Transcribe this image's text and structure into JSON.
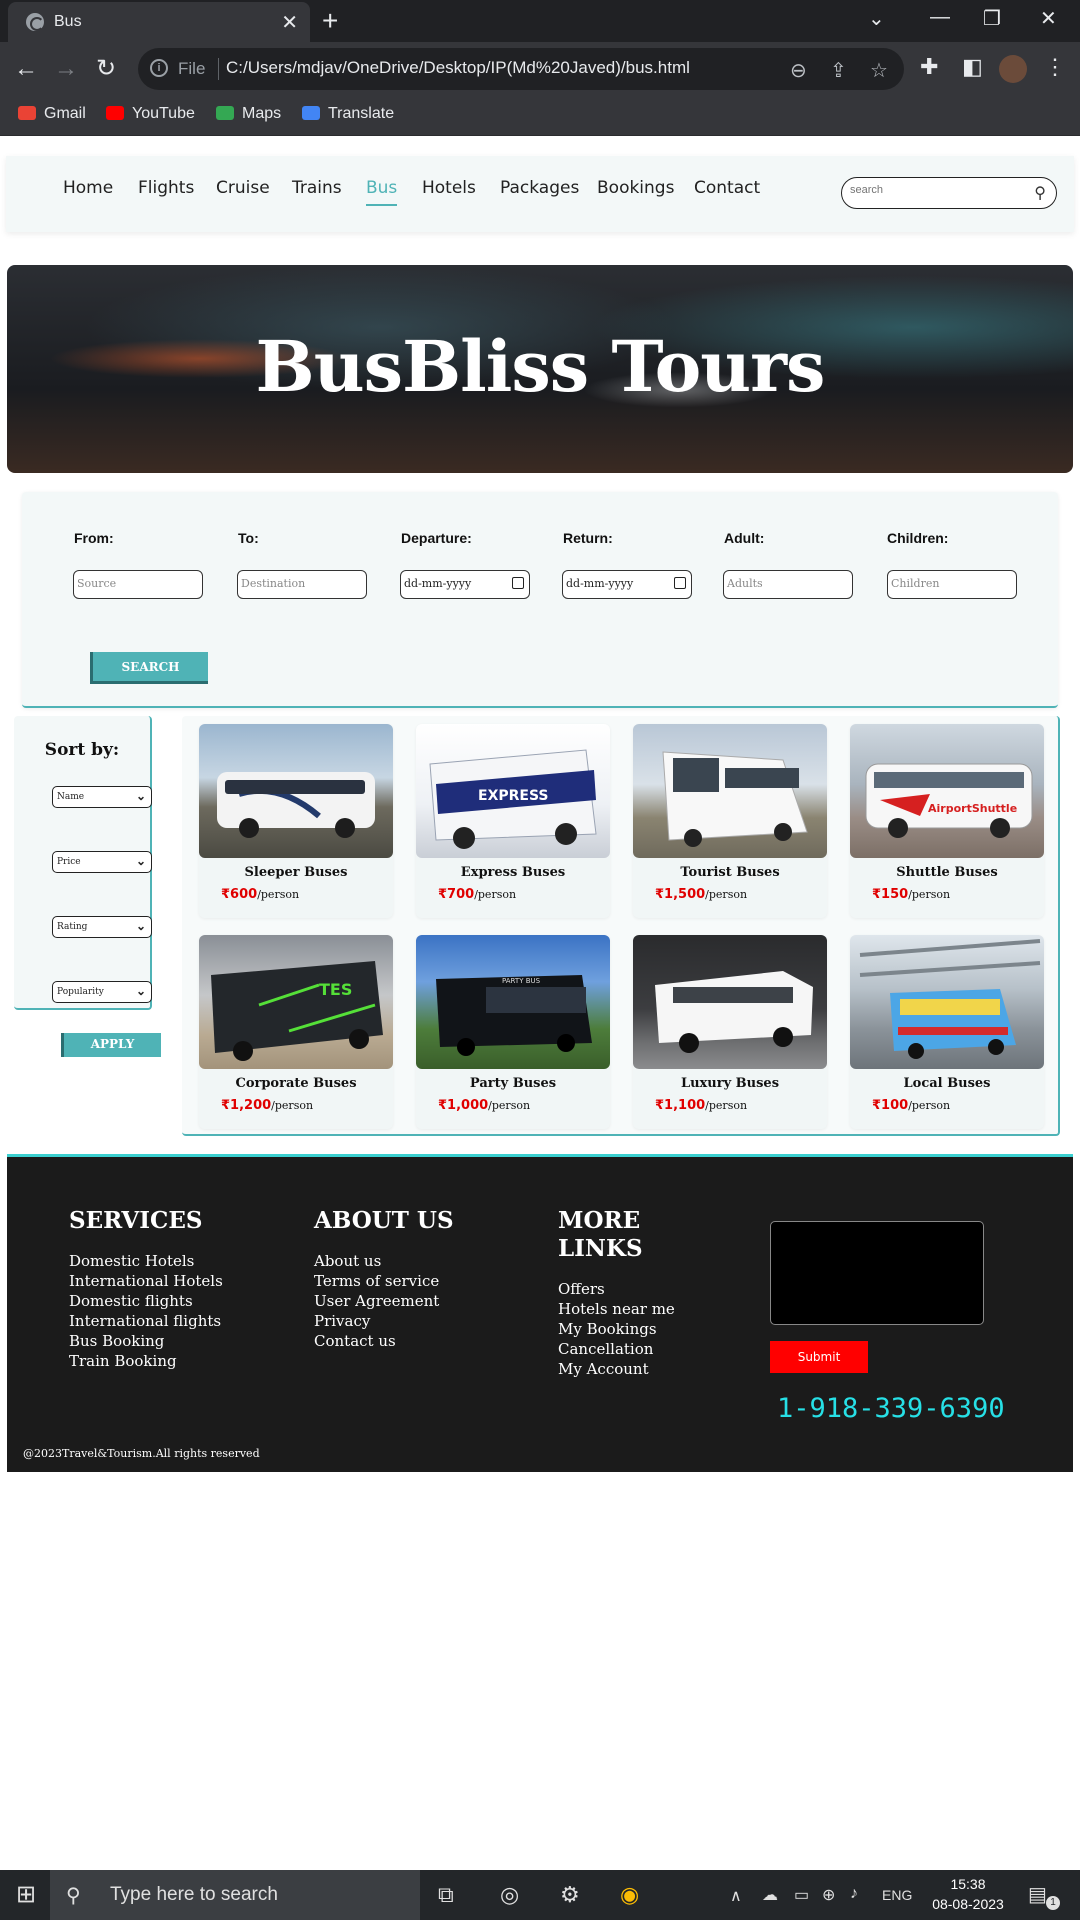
{
  "browser": {
    "tab_title": "Bus",
    "url_scheme": "File",
    "url": "C:/Users/mdjav/OneDrive/Desktop/IP(Md%20Javed)/bus.html",
    "bookmarks": [
      "Gmail",
      "YouTube",
      "Maps",
      "Translate"
    ]
  },
  "nav": {
    "links": [
      "Home",
      "Flights",
      "Cruise",
      "Trains",
      "Bus",
      "Hotels",
      "Packages",
      "Bookings",
      "Contact"
    ],
    "active": "Bus",
    "search_placeholder": "search"
  },
  "hero": {
    "title": "BusBliss Tours"
  },
  "search_form": {
    "from_label": "From:",
    "from_placeholder": "Source",
    "to_label": "To:",
    "to_placeholder": "Destination",
    "departure_label": "Departure:",
    "departure_value": "dd-mm-yyyy",
    "return_label": "Return:",
    "return_value": "dd-mm-yyyy",
    "adult_label": "Adult:",
    "adult_placeholder": "Adults",
    "children_label": "Children:",
    "children_placeholder": "Children",
    "search_button": "SEARCH"
  },
  "sidebar": {
    "title": "Sort by:",
    "selects": [
      "Name",
      "Price",
      "Rating",
      "Popularity"
    ],
    "apply_button": "APPLY"
  },
  "buses": [
    {
      "name": "Sleeper Buses",
      "price": "₹600",
      "unit": "/person"
    },
    {
      "name": "Express Buses",
      "price": "₹700",
      "unit": "/person"
    },
    {
      "name": "Tourist Buses",
      "price": "₹1,500",
      "unit": "/person"
    },
    {
      "name": "Shuttle Buses",
      "price": "₹150",
      "unit": "/person"
    },
    {
      "name": "Corporate Buses",
      "price": "₹1,200",
      "unit": "/person"
    },
    {
      "name": "Party Buses",
      "price": "₹1,000",
      "unit": "/person"
    },
    {
      "name": "Luxury Buses",
      "price": "₹1,100",
      "unit": "/person"
    },
    {
      "name": "Local Buses",
      "price": "₹100",
      "unit": "/person"
    }
  ],
  "footer": {
    "services_title": "SERVICES",
    "services": [
      "Domestic Hotels",
      "International Hotels",
      "Domestic flights",
      "International flights",
      "Bus Booking",
      "Train Booking"
    ],
    "about_title": "ABOUT US",
    "about": [
      "About us",
      "Terms of service",
      "User Agreement",
      "Privacy",
      "Contact us"
    ],
    "more_title_1": "MORE",
    "more_title_2": "LINKS",
    "more": [
      "Offers",
      "Hotels near me",
      "My Bookings",
      "Cancellation",
      "My Account"
    ],
    "submit_button": "Submit",
    "phone": "1-918-339-6390",
    "copyright": "@2023Travel&Tourism.All rights reserved"
  },
  "taskbar": {
    "search_placeholder": "Type here to search",
    "language": "ENG",
    "time": "15:38",
    "date": "08-08-2023",
    "notification_count": "1"
  },
  "colors": {
    "accent": "#4fb3b6",
    "price": "#e00000",
    "footer_bg": "#1b1b1b",
    "phone": "#27e0e6",
    "submit": "#ff0000"
  }
}
